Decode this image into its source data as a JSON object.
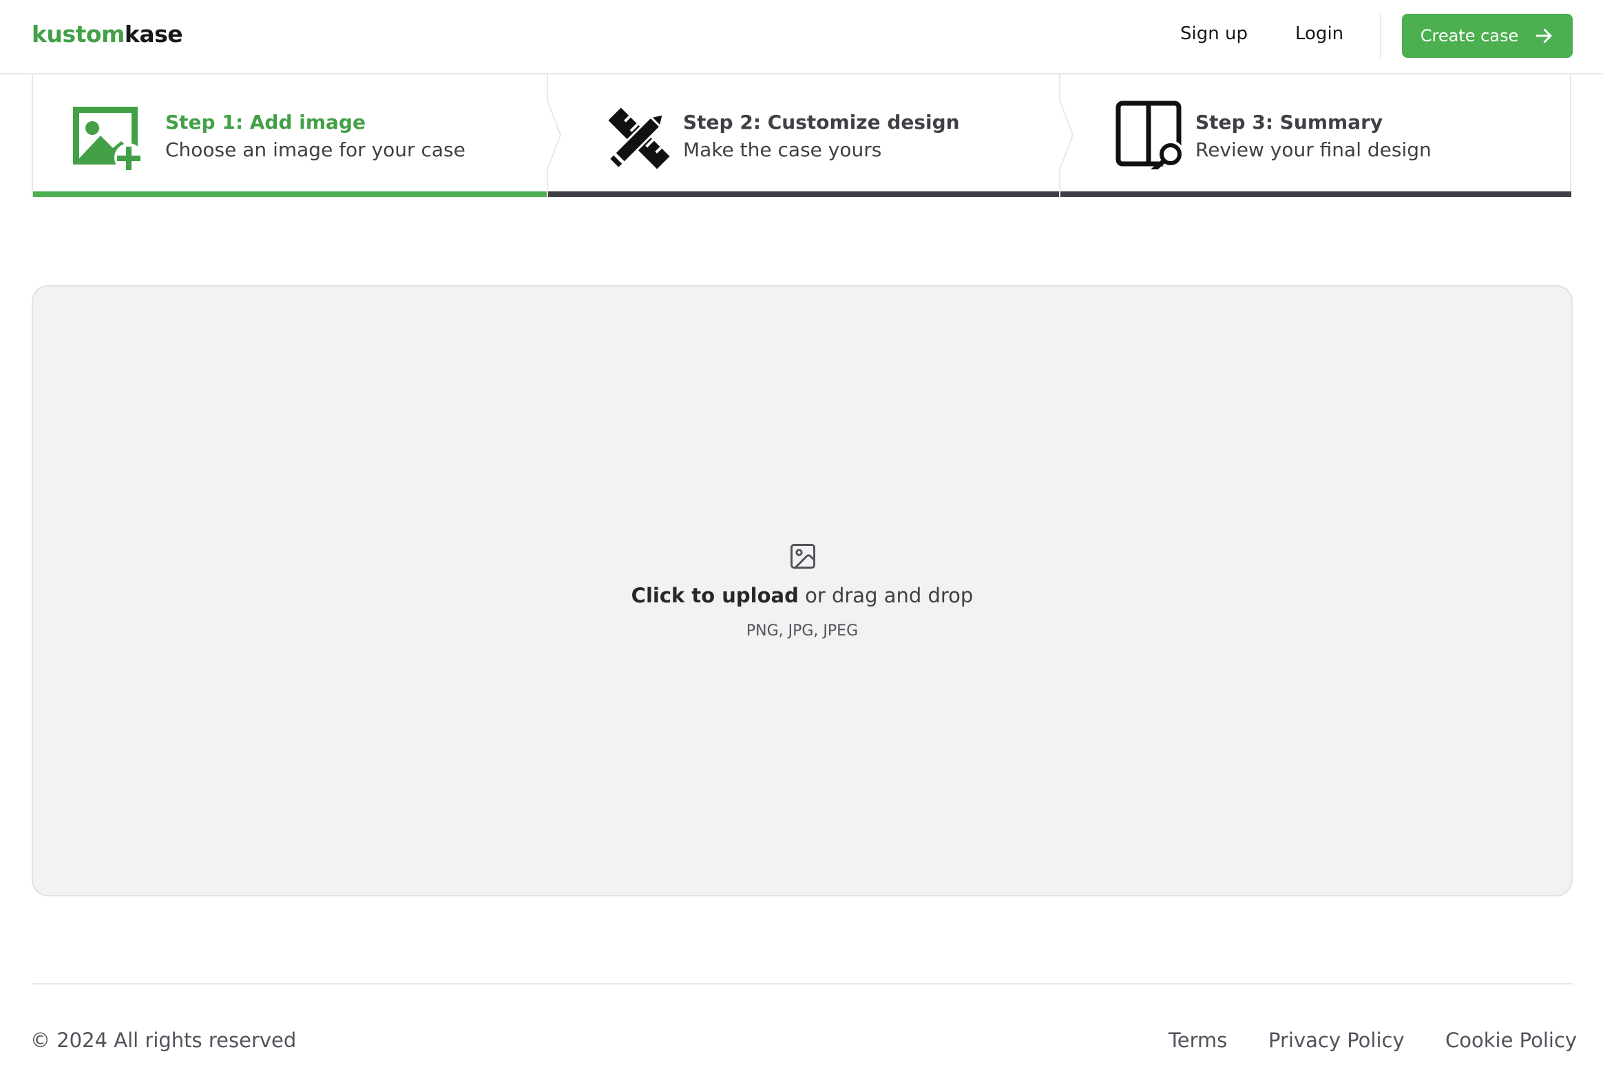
{
  "nav": {
    "logo_part1": "kustom",
    "logo_part2": "kase",
    "signup": "Sign up",
    "login": "Login",
    "cta": "Create case",
    "cta_icon": "arrow-right-icon"
  },
  "steps": [
    {
      "title": "Step 1: Add image",
      "desc": "Choose an image for your case",
      "icon": "image-plus-icon",
      "status": "active"
    },
    {
      "title": "Step 2: Customize design",
      "desc": "Make the case yours",
      "icon": "pencil-ruler-icon",
      "status": "upcoming"
    },
    {
      "title": "Step 3: Summary",
      "desc": "Review your final design",
      "icon": "file-search-icon",
      "status": "upcoming"
    }
  ],
  "dropzone": {
    "icon": "image-icon",
    "bold": "Click to upload",
    "rest": " or drag and drop",
    "types": "PNG, JPG, JPEG"
  },
  "footer": {
    "copyright": "© 2024 All rights reserved",
    "links": [
      "Terms",
      "Privacy Policy",
      "Cookie Policy"
    ]
  },
  "colors": {
    "brand_green": "#4caf50",
    "inactive_bar": "#3f3f46",
    "dropzone_bg": "#f2f2f2"
  }
}
